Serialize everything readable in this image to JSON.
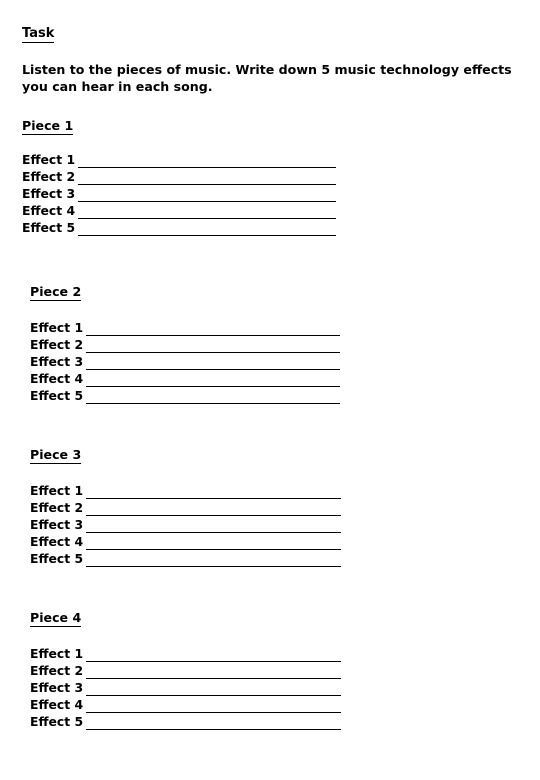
{
  "document": {
    "task_heading": "Task",
    "instructions": "Listen to the pieces of music. Write down 5 music technology effects you can hear in each song.",
    "sections": [
      {
        "heading": "Piece 1",
        "effects": [
          "Effect 1",
          "Effect 2",
          "Effect 3",
          "Effect 4",
          "Effect 5"
        ]
      },
      {
        "heading": "Piece 2",
        "effects": [
          "Effect 1",
          "Effect 2",
          "Effect 3",
          "Effect 4",
          "Effect 5"
        ]
      },
      {
        "heading": "Piece 3",
        "effects": [
          "Effect 1",
          "Effect 2",
          "Effect 3",
          "Effect 4",
          "Effect 5"
        ]
      },
      {
        "heading": "Piece 4",
        "effects": [
          "Effect 1",
          "Effect 2",
          "Effect 3",
          "Effect 4",
          "Effect 5"
        ]
      }
    ]
  },
  "style": {
    "page_background": "#ffffff",
    "text_color": "#000000",
    "rule_color": "#000000"
  }
}
